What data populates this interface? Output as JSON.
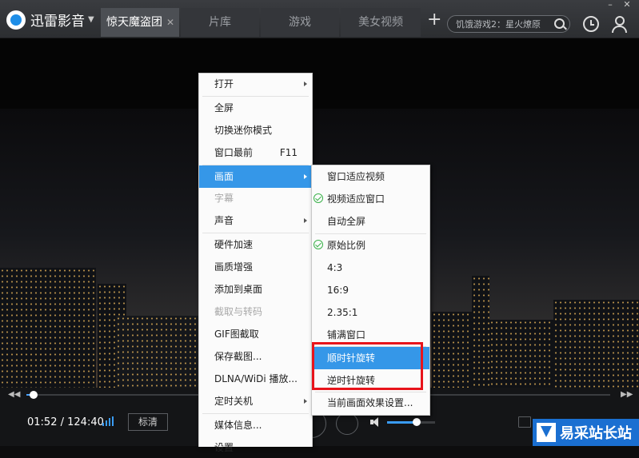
{
  "app": {
    "name": "迅雷影音"
  },
  "tabs": [
    {
      "label": "惊天魔盗团",
      "active": true
    },
    {
      "label": "片库"
    },
    {
      "label": "游戏"
    },
    {
      "label": "美女视频"
    }
  ],
  "search": {
    "placeholder": "饥饿游戏2：星火燎原"
  },
  "player": {
    "time_current": "01:52",
    "time_sep": " / ",
    "time_total": "124:40",
    "quality_label": "标清",
    "progress": 0.013,
    "volume": 0.62
  },
  "context_menu": {
    "items": [
      {
        "label": "打开",
        "submenu": true
      },
      {
        "label": "全屏"
      },
      {
        "label": "切换迷你模式"
      },
      {
        "label": "窗口最前",
        "shortcut": "F11"
      },
      {
        "label": "画面",
        "submenu": true,
        "highlighted": true
      },
      {
        "label": "字幕",
        "disabled": true
      },
      {
        "label": "声音",
        "submenu": true
      },
      {
        "label": "硬件加速"
      },
      {
        "label": "画质增强"
      },
      {
        "label": "添加到桌面"
      },
      {
        "label": "截取与转码",
        "disabled": true
      },
      {
        "label": "GIF图截取"
      },
      {
        "label": "保存截图..."
      },
      {
        "label": "DLNA/WiDi 播放..."
      },
      {
        "label": "定时关机",
        "submenu": true
      },
      {
        "label": "媒体信息..."
      },
      {
        "label": "设置"
      }
    ]
  },
  "picture_submenu": {
    "items": [
      {
        "label": "窗口适应视频"
      },
      {
        "label": "视频适应窗口",
        "checked": true
      },
      {
        "label": "自动全屏"
      },
      {
        "label": "原始比例",
        "checked": true
      },
      {
        "label": "4:3"
      },
      {
        "label": "16:9"
      },
      {
        "label": "2.35:1"
      },
      {
        "label": "铺满窗口"
      },
      {
        "label": "顺时针旋转",
        "highlighted": true
      },
      {
        "label": "逆时针旋转"
      },
      {
        "label": "当前画面效果设置..."
      }
    ]
  },
  "watermark": {
    "text": "易采站长站"
  },
  "colors": {
    "accent": "#3597e8",
    "highlight_box": "#e8141b",
    "check": "#3bb24a"
  }
}
